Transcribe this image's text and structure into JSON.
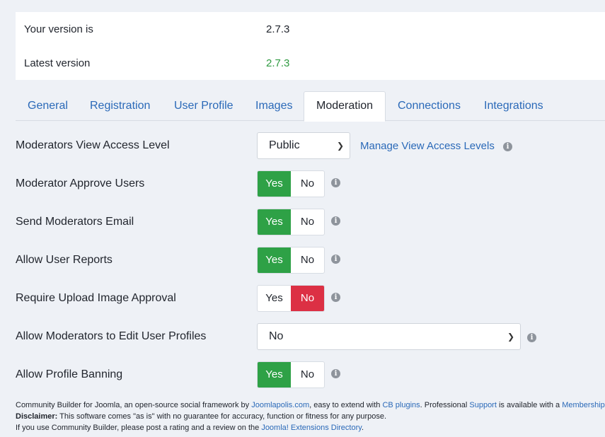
{
  "version": {
    "current_label": "Your version is",
    "current_value": "2.7.3",
    "latest_label": "Latest version",
    "latest_value": "2.7.3",
    "latest_color": "#2f9a41"
  },
  "tabs": [
    {
      "label": "General"
    },
    {
      "label": "Registration"
    },
    {
      "label": "User Profile"
    },
    {
      "label": "Images"
    },
    {
      "label": "Moderation",
      "active": true
    },
    {
      "label": "Connections"
    },
    {
      "label": "Integrations"
    }
  ],
  "moderation": {
    "view_access": {
      "label": "Moderators View Access Level",
      "selected": "Public",
      "link": "Manage View Access Levels"
    },
    "approve_users": {
      "label": "Moderator Approve Users",
      "value": "Yes"
    },
    "send_email": {
      "label": "Send Moderators Email",
      "value": "Yes"
    },
    "user_reports": {
      "label": "Allow User Reports",
      "value": "Yes"
    },
    "image_approval": {
      "label": "Require Upload Image Approval",
      "value": "No"
    },
    "edit_profiles": {
      "label": "Allow Moderators to Edit User Profiles",
      "selected": "No"
    },
    "profile_banning": {
      "label": "Allow Profile Banning",
      "value": "Yes"
    },
    "yes_label": "Yes",
    "no_label": "No"
  },
  "colors": {
    "yes": "#2ea146",
    "no": "#dc3044",
    "link": "#2a69b8"
  },
  "footer": {
    "l1_a": "Community Builder for Joomla, an open-source social framework by ",
    "l1_link1": "Joomlapolis.com",
    "l1_b": ", easy to extend with ",
    "l1_link2": "CB plugins",
    "l1_c": ". Professional ",
    "l1_link3": "Support",
    "l1_d": " is available with a ",
    "l1_link4": "Membership",
    "l1_e": ".",
    "l2_bold": "Disclaimer:",
    "l2_text": " This software comes \"as is\" with no guarantee for accuracy, function or fitness for any purpose.",
    "l3_text": "If you use Community Builder, please post a rating and a review on the ",
    "l3_link": "Joomla! Extensions Directory",
    "l3_end": "."
  }
}
